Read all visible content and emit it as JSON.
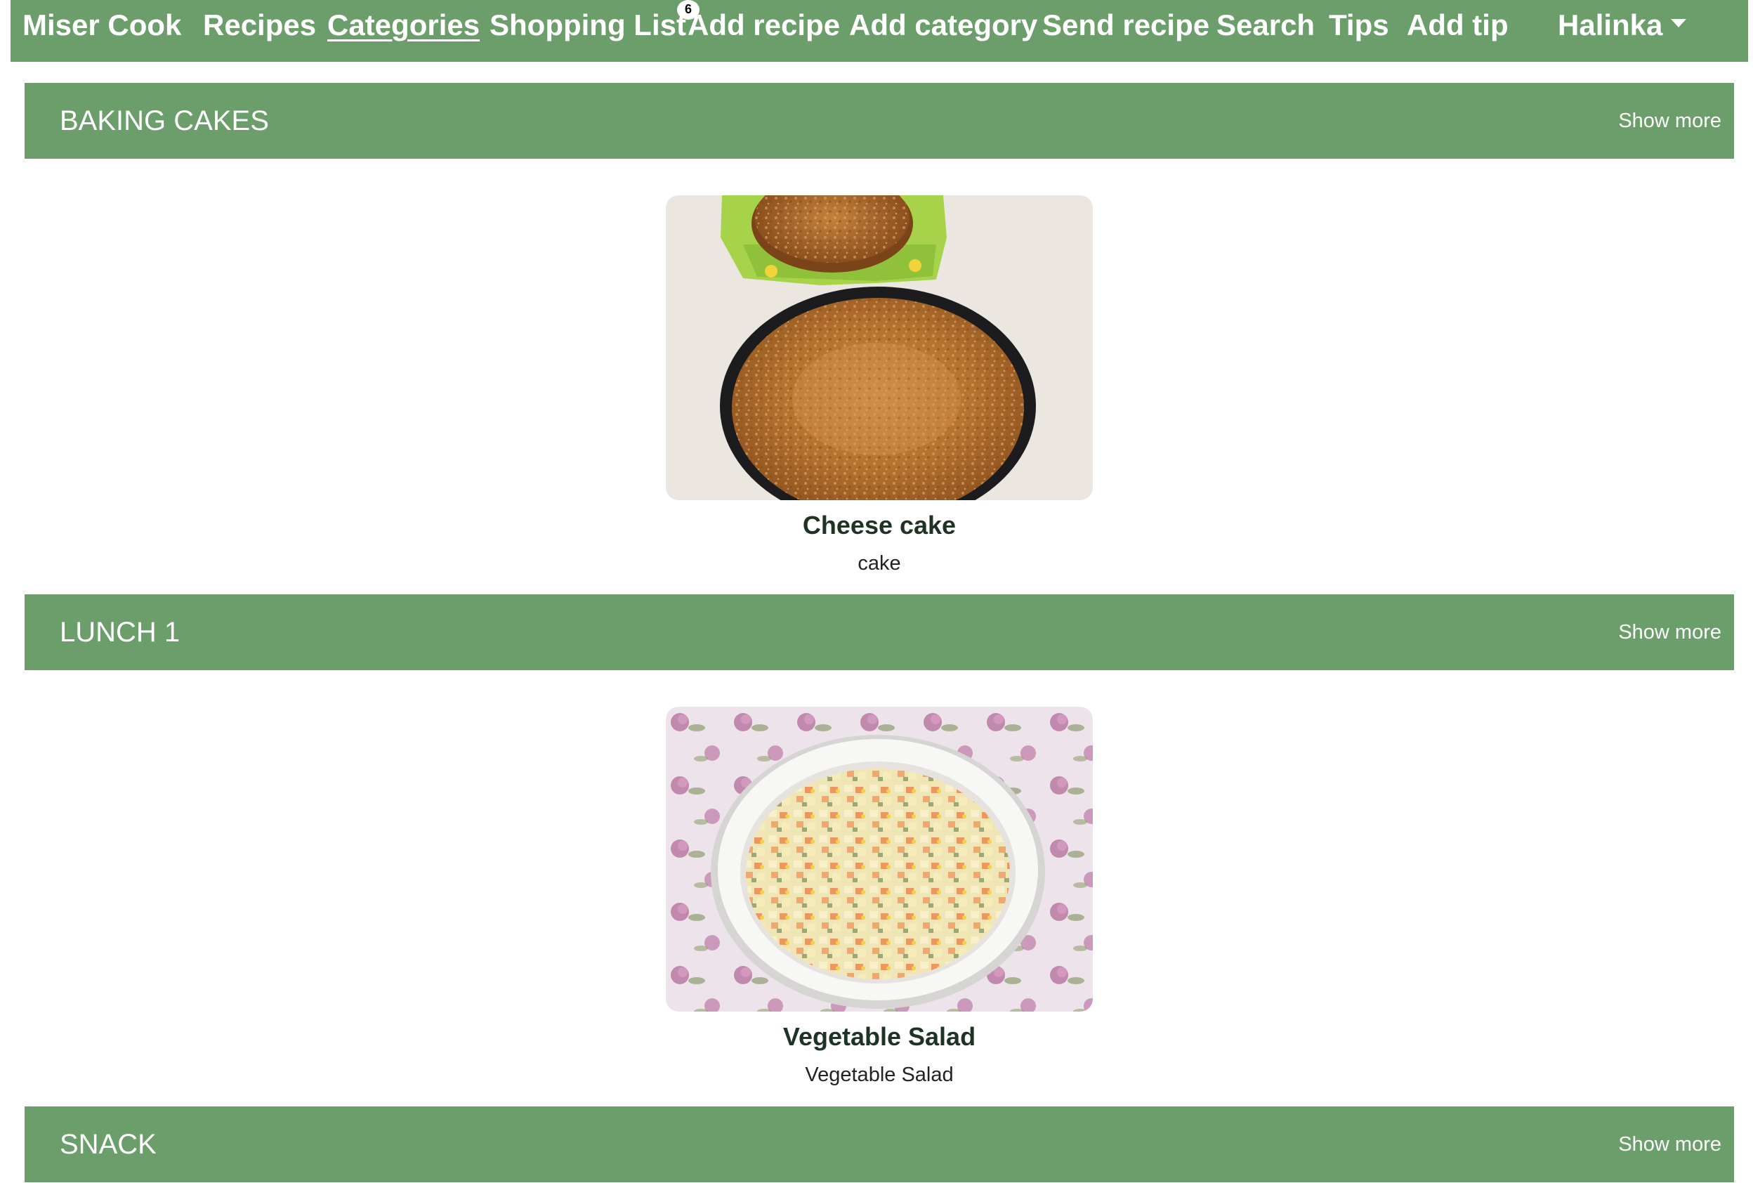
{
  "navbar": {
    "brand": "Miser Cook",
    "items": [
      {
        "label": "Recipes"
      },
      {
        "label": "Categories",
        "active": true
      },
      {
        "label": "Shopping List",
        "badge": "6"
      },
      {
        "label": "Add recipe"
      },
      {
        "label": "Add category"
      },
      {
        "label": "Send recipe"
      },
      {
        "label": "Search"
      },
      {
        "label": "Tips"
      },
      {
        "label": "Add tip"
      }
    ],
    "user": "Halinka"
  },
  "sections": [
    {
      "title": "BAKING CAKES",
      "show_more": "Show more",
      "recipe": {
        "title": "Cheese cake",
        "description": "cake",
        "image": "cheesecake-photo"
      }
    },
    {
      "title": "LUNCH 1",
      "show_more": "Show more",
      "recipe": {
        "title": "Vegetable Salad",
        "description": "Vegetable Salad",
        "image": "vegetable-salad-photo"
      }
    },
    {
      "title": "SNACK",
      "show_more": "Show more"
    }
  ],
  "colors": {
    "header_green": "#6b9e6a",
    "title_dark_green": "#1f3324"
  }
}
